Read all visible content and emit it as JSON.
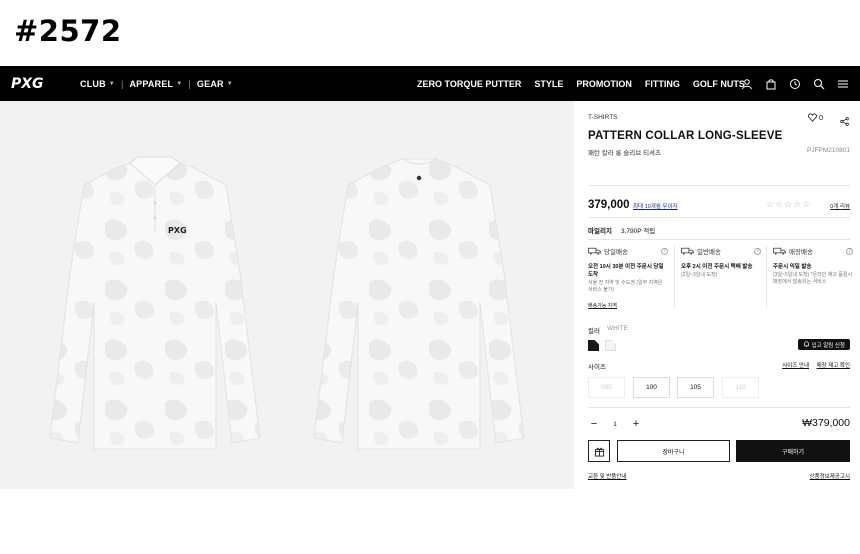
{
  "page_tag": "#2572",
  "brand": {
    "logo_text": "PXG"
  },
  "nav": {
    "left_items": [
      {
        "label": "CLUB"
      },
      {
        "label": "APPAREL"
      },
      {
        "label": "GEAR"
      }
    ],
    "right_items": [
      "ZERO TORQUE PUTTER",
      "STYLE",
      "PROMOTION",
      "FITTING",
      "GOLF NUTS"
    ],
    "icons": [
      "user-icon",
      "bag-icon",
      "history-icon",
      "search-icon",
      "menu-icon"
    ]
  },
  "product": {
    "category": "T-SHIRTS",
    "wish_count": "0",
    "title": "PATTERN COLLAR LONG-SLEEVE",
    "subtitle": "패턴 칼라 롱 슬리브 티셔츠",
    "sku": "PJFPM210801",
    "price": "379,000",
    "installment_link": "최대 10개월 무이자",
    "stars": "☆☆☆☆☆",
    "review_link": "0개 리뷰",
    "mileage_label": "마일리지",
    "mileage_value": "3,790P 적립"
  },
  "shipping": [
    {
      "label": "당일배송",
      "title": "오전 10시 30분 이전 주문시 당일도착",
      "desc": "서울 전 지역 및 수도권 (일부 지역은 서비스 불가)",
      "link": "배송가능 지역"
    },
    {
      "label": "일반배송",
      "title": "오후 2시 이전 주문시 택배 발송",
      "desc": "(2일~3일내 도착)",
      "link": ""
    },
    {
      "label": "매장배송",
      "title": "주문시 익일 발송",
      "desc": "(3일~5일내 도착) *온라인 재고 품절시 매장에서 발송되는 서비스",
      "link": ""
    }
  ],
  "color": {
    "label": "컬러",
    "selected_name": "WHITE",
    "swatches": [
      "#1a1a1a",
      "#f4f4f4"
    ],
    "restock_button": "입고 알림 신청"
  },
  "size": {
    "label": "사이즈",
    "guide_link": "사이즈 안내",
    "stock_link": "매장 재고 확인",
    "options": [
      {
        "label": "095",
        "available": false
      },
      {
        "label": "100",
        "available": true
      },
      {
        "label": "105",
        "available": true
      },
      {
        "label": "110",
        "available": false
      }
    ]
  },
  "quantity": {
    "minus": "−",
    "value": "1",
    "plus": "+"
  },
  "total_price": "₩379,000",
  "actions": {
    "cart": "장바구니",
    "buy": "구매하기"
  },
  "footer": {
    "left_link": "교환 및 반품안내",
    "right_link": "상품정보제공고시"
  }
}
